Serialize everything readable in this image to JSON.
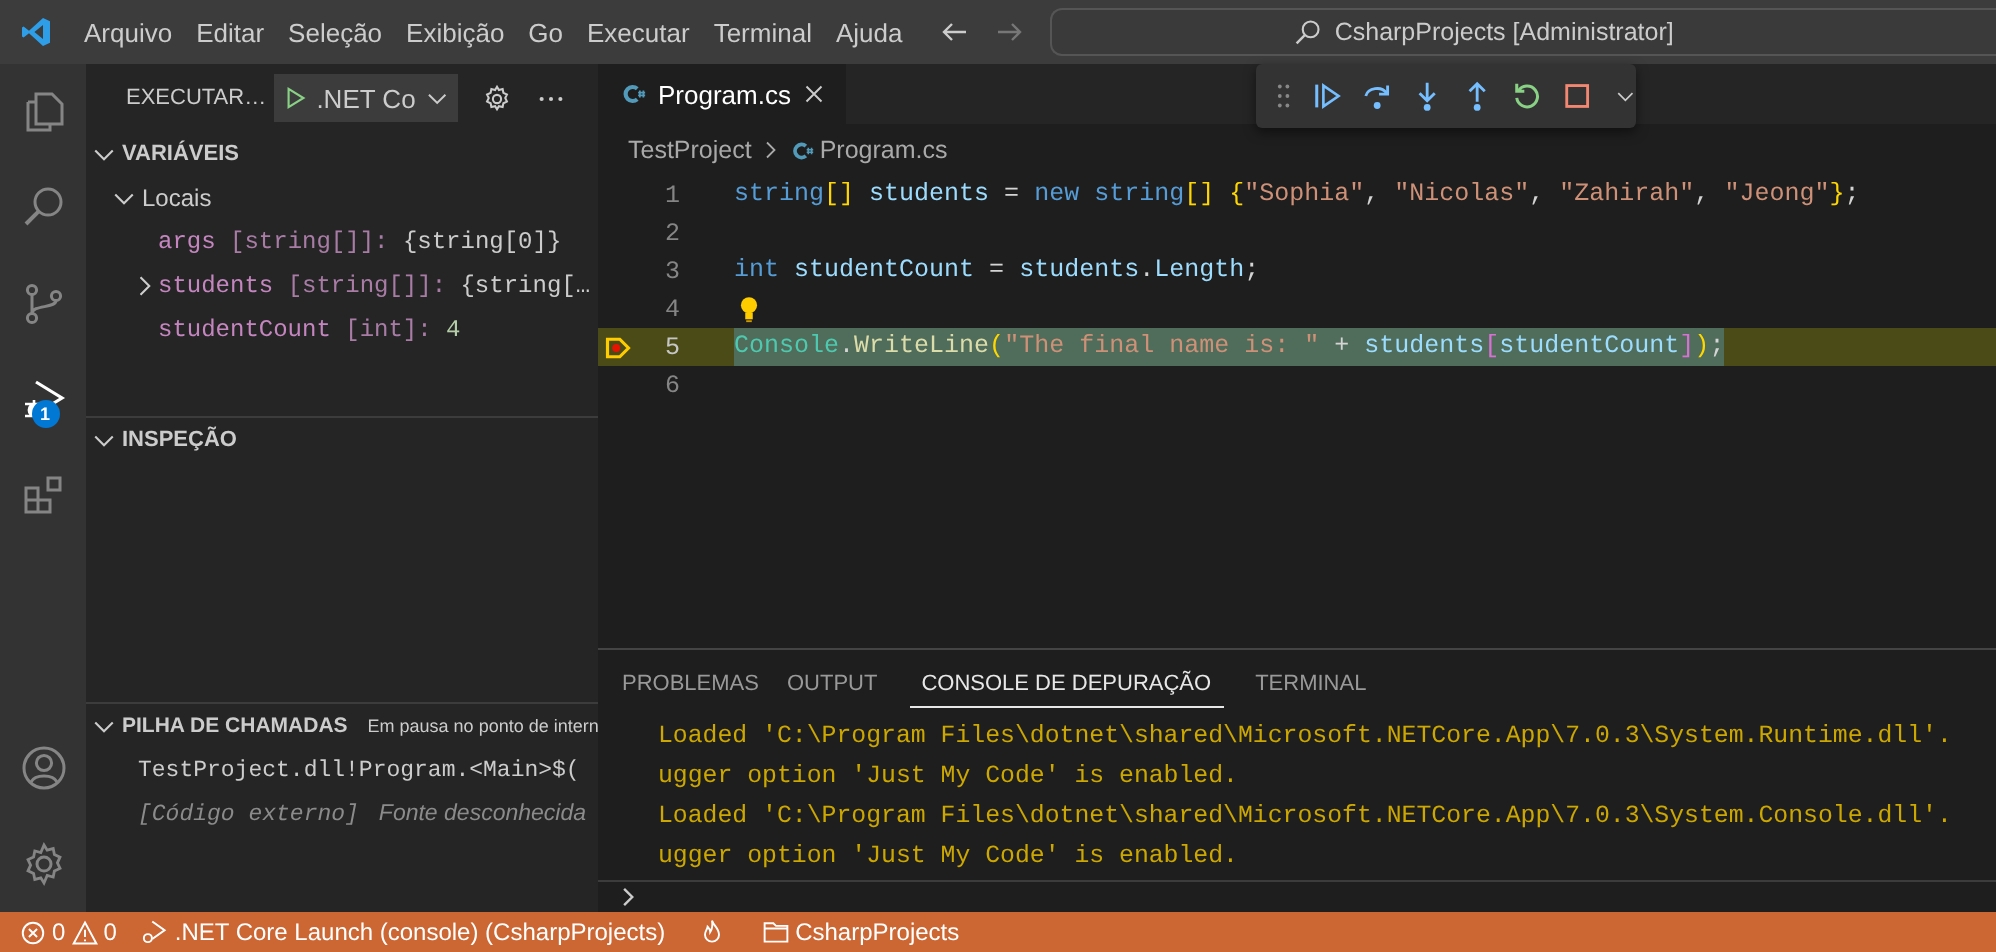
{
  "title_bar": {
    "menus": [
      "Arquivo",
      "Editar",
      "Seleção",
      "Exibição",
      "Go",
      "Executar",
      "Terminal",
      "Ajuda"
    ],
    "command_center": "CsharpProjects [Administrator]"
  },
  "activity_bar": {
    "items": [
      {
        "kind": "explorer",
        "selected": false
      },
      {
        "kind": "search",
        "selected": false
      },
      {
        "kind": "source_control",
        "selected": false
      },
      {
        "kind": "debug",
        "selected": true,
        "badge": "1"
      },
      {
        "kind": "extensions",
        "selected": false
      }
    ],
    "bottom": [
      {
        "kind": "account"
      },
      {
        "kind": "manage"
      }
    ]
  },
  "sidebar": {
    "title": "EXECUTAR…",
    "config": ".NET Co",
    "variables": {
      "title": "VARIÁVEIS",
      "expanded": true,
      "scopes": [
        {
          "name": "Locais",
          "expanded": true,
          "children": [
            {
              "kind": "leaf",
              "name": "args",
              "type": "[string[]]:",
              "value": "{string[0]}",
              "color": "#cccccc"
            },
            {
              "kind": "node",
              "expanded": false,
              "name": "students",
              "type": "[string[]]:",
              "value": "{string[…",
              "color": "#cccccc"
            },
            {
              "kind": "leaf",
              "name": "studentCount",
              "type": "[int]:",
              "value": "4",
              "color": "#b5cea8"
            }
          ]
        }
      ]
    },
    "watch": {
      "title": "INSPEÇÃO",
      "expanded": true
    },
    "call_stack": {
      "title": "PILHA DE CHAMADAS",
      "expanded": true,
      "status": "Em pausa no ponto de intern",
      "frames": [
        {
          "kind": "frame",
          "name": "TestProject.dll!Program.<Main>$("
        },
        {
          "kind": "external",
          "name": "[Código externo]",
          "source": "Fonte desconhecida"
        }
      ]
    }
  },
  "editor": {
    "tabs": [
      {
        "label": "Program.cs",
        "selected": true
      }
    ],
    "breadcrumb": [
      "TestProject",
      "Program.cs"
    ],
    "lines": [
      {
        "number": "1",
        "current": false,
        "lightbulb": false,
        "tokens": [
          {
            "color": "#569cd6",
            "t": "string"
          },
          {
            "color": "#ffd700",
            "t": "[]"
          },
          {
            "color": "#9cdcfe",
            "t": " students"
          },
          {
            "color": "#d4d4d4",
            "t": " = "
          },
          {
            "color": "#569cd6",
            "t": "new string"
          },
          {
            "color": "#ffd700",
            "t": "[] {"
          },
          {
            "color": "#ce9178",
            "t": "\"Sophia\""
          },
          {
            "color": "#d4d4d4",
            "t": ", "
          },
          {
            "color": "#ce9178",
            "t": "\"Nicolas\""
          },
          {
            "color": "#d4d4d4",
            "t": ", "
          },
          {
            "color": "#ce9178",
            "t": "\"Zahirah\""
          },
          {
            "color": "#d4d4d4",
            "t": ", "
          },
          {
            "color": "#ce9178",
            "t": "\"Jeong\""
          },
          {
            "color": "#ffd700",
            "t": "}"
          },
          {
            "color": "#d4d4d4",
            "t": ";"
          }
        ]
      },
      {
        "number": "2",
        "current": false,
        "lightbulb": false
      },
      {
        "number": "3",
        "current": false,
        "lightbulb": false,
        "tokens": [
          {
            "color": "#569cd6",
            "t": "int"
          },
          {
            "color": "#9cdcfe",
            "t": " studentCount"
          },
          {
            "color": "#d4d4d4",
            "t": " = "
          },
          {
            "color": "#9cdcfe",
            "t": "students"
          },
          {
            "color": "#d4d4d4",
            "t": "."
          },
          {
            "color": "#9cdcfe",
            "t": "Length"
          },
          {
            "color": "#d4d4d4",
            "t": ";"
          }
        ]
      },
      {
        "number": "4",
        "current": false,
        "lightbulb": true
      },
      {
        "number": "5",
        "current": true,
        "lightbulb": false,
        "tokens": [
          {
            "color": "#4ec9b0",
            "t": "Console"
          },
          {
            "color": "#d4d4d4",
            "t": "."
          },
          {
            "color": "#dcdcaa",
            "t": "WriteLine"
          },
          {
            "color": "#ffd700",
            "t": "("
          },
          {
            "color": "#ce9178",
            "t": "\"The final name is: \""
          },
          {
            "color": "#d4d4d4",
            "t": " + "
          },
          {
            "color": "#9cdcfe",
            "t": "students"
          },
          {
            "color": "#da70d6",
            "t": "["
          },
          {
            "color": "#9cdcfe",
            "t": "studentCount"
          },
          {
            "color": "#da70d6",
            "t": "]"
          },
          {
            "color": "#ffd700",
            "t": ")"
          },
          {
            "color": "#d4d4d4",
            "t": ";"
          }
        ]
      },
      {
        "number": "6",
        "current": false,
        "lightbulb": false
      }
    ]
  },
  "panel": {
    "tabs": [
      {
        "label": "PROBLEMAS",
        "selected": false
      },
      {
        "label": "OUTPUT",
        "selected": false
      },
      {
        "label": "CONSOLE DE DEPURAÇÃO",
        "selected": true
      },
      {
        "label": "TERMINAL",
        "selected": false
      }
    ],
    "lines": [
      "Loaded 'C:\\Program Files\\dotnet\\shared\\Microsoft.NETCore.App\\7.0.3\\System.Runtime.dll'.",
      "ugger option 'Just My Code' is enabled.",
      "Loaded 'C:\\Program Files\\dotnet\\shared\\Microsoft.NETCore.App\\7.0.3\\System.Console.dll'.",
      "ugger option 'Just My Code' is enabled."
    ]
  },
  "status_bar": {
    "errors": "0",
    "warnings": "0",
    "launch": ".NET Core Launch (console) (CsharpProjects)",
    "folder": "CsharpProjects"
  }
}
